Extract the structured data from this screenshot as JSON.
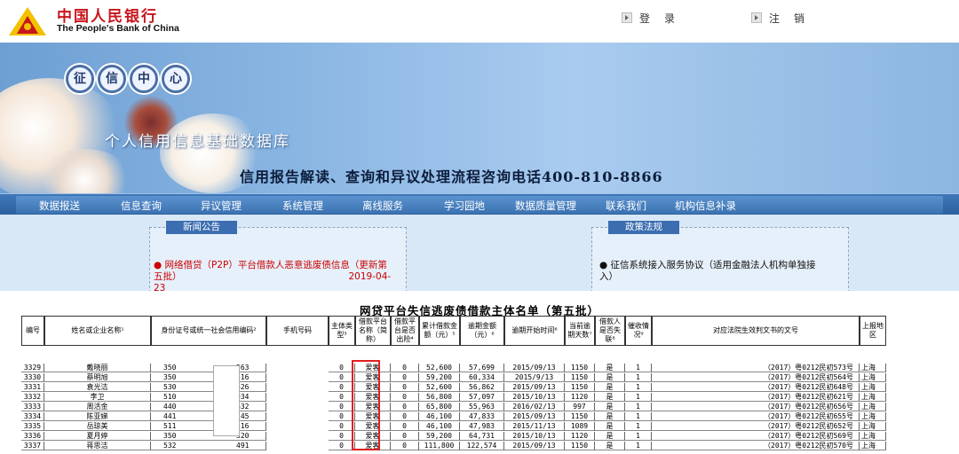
{
  "header": {
    "logo_cn": "中国人民银行",
    "logo_en": "The People's Bank of China",
    "login": "登录",
    "logout": "注销"
  },
  "banner": {
    "badge_chars": [
      "征",
      "信",
      "中",
      "心"
    ],
    "subtitle": "个人信用信息基础数据库",
    "hotline": "信用报告解读、查询和异议处理流程咨询电话400-810-8866"
  },
  "nav": {
    "items": [
      "数据报送",
      "信息查询",
      "异议管理",
      "系统管理",
      "离线服务",
      "学习园地",
      "数据质量管理",
      "联系我们",
      "机构信息补录"
    ]
  },
  "news": {
    "title": "新闻公告",
    "item_line1": "网络借贷（P2P）平台借款人恶意逃废债信息（更新第",
    "item_line2": "五批）",
    "item_date": "2019-04-23"
  },
  "policy": {
    "title": "政策法规",
    "item_line1": "征信系统接入服务协议（适用金融法人机构单独接",
    "item_line2": "入）"
  },
  "table": {
    "title": "网贷平台失信逃废债借款主体名单（第五批）",
    "headers": [
      "编号",
      "姓名或企业名称¹",
      "身份证号或统一社会信用编码²",
      "手机号码",
      "主体类型³",
      "借款平台名称（简称）",
      "借款平台是否出险⁴",
      "累计借款金额（元）⁵",
      "逾期金额（元）⁶",
      "逾期开始时间⁶",
      "当前逾期天数⁷",
      "借款人是否失联⁸",
      "催收情况⁹",
      "对应法院生效判文书的文号",
      "上报地区"
    ],
    "rows": [
      [
        "3329",
        "戴晓丽",
        "350",
        "563",
        "0",
        "爱客",
        "0",
        "52,600",
        "57,699",
        "2015/09/13",
        "1150",
        "是",
        "1",
        "（2017）粤0212民初573号",
        "上海"
      ],
      [
        "3330",
        "蔡明旭",
        "350",
        "516",
        "0",
        "爱客",
        "0",
        "59,200",
        "60,334",
        "2015/9/13",
        "1150",
        "是",
        "1",
        "（2017）粤0212民初564号",
        "上海"
      ],
      [
        "3331",
        "袁光洁",
        "530",
        "626",
        "0",
        "爱客",
        "0",
        "52,600",
        "56,862",
        "2015/09/13",
        "1150",
        "是",
        "1",
        "（2017）粤0212民初648号",
        "上海"
      ],
      [
        "3332",
        "李卫",
        "510",
        "934",
        "0",
        "爱客",
        "0",
        "56,800",
        "57,097",
        "2015/10/13",
        "1120",
        "是",
        "1",
        "（2017）粤0212民初621号",
        "上海"
      ],
      [
        "3333",
        "周活金",
        "440",
        "632",
        "0",
        "爱客",
        "0",
        "65,800",
        "55,963",
        "2016/02/13",
        "997",
        "是",
        "1",
        "（2017）粤0212民初656号",
        "上海"
      ],
      [
        "3334",
        "陈亚娣",
        "441",
        "245",
        "0",
        "爱客",
        "0",
        "46,100",
        "47,833",
        "2015/09/13",
        "1150",
        "是",
        "1",
        "（2017）粤0212民初655号",
        "上海"
      ],
      [
        "3335",
        "岳琼美",
        "511",
        "216",
        "0",
        "爱客",
        "0",
        "46,100",
        "47,983",
        "2015/11/13",
        "1089",
        "是",
        "1",
        "（2017）粤0212民初652号",
        "上海"
      ],
      [
        "3336",
        "夏月婷",
        "350",
        "320",
        "0",
        "爱客",
        "0",
        "59,200",
        "64,731",
        "2015/10/13",
        "1120",
        "是",
        "1",
        "（2017）粤0212民初569号",
        "上海"
      ],
      [
        "3337",
        "蒋思洁",
        "532",
        "491",
        "0",
        "爱客",
        "0",
        "111,800",
        "122,574",
        "2015/09/13",
        "1150",
        "是",
        "1",
        "（2017）粤0212民初570号",
        "上海"
      ]
    ]
  }
}
